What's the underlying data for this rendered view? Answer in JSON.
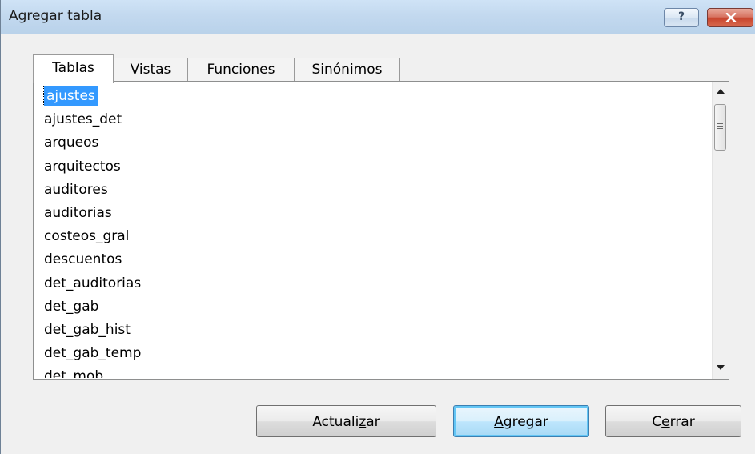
{
  "window": {
    "title": "Agregar tabla",
    "help_label": "?"
  },
  "tabs": [
    {
      "label": "Tablas",
      "active": true
    },
    {
      "label": "Vistas",
      "active": false
    },
    {
      "label": "Funciones",
      "active": false
    },
    {
      "label": "Sinónimos",
      "active": false
    }
  ],
  "list": {
    "selected": "ajustes",
    "items": [
      "ajustes",
      "ajustes_det",
      "arqueos",
      "arquitectos",
      "auditores",
      "auditorias",
      "costeos_gral",
      "descuentos",
      "det_auditorias",
      "det_gab",
      "det_gab_hist",
      "det_gab_temp",
      "det_mob"
    ]
  },
  "buttons": {
    "refresh": {
      "before": "Actuali",
      "mnemonic": "z",
      "after": "ar"
    },
    "add": {
      "before": "",
      "mnemonic": "A",
      "after": "gregar"
    },
    "close": {
      "before": "C",
      "mnemonic": "e",
      "after": "rrar"
    }
  },
  "colors": {
    "selection": "#3399ff",
    "titlebar": "#c3d9ef",
    "close_button": "#c8462f"
  }
}
